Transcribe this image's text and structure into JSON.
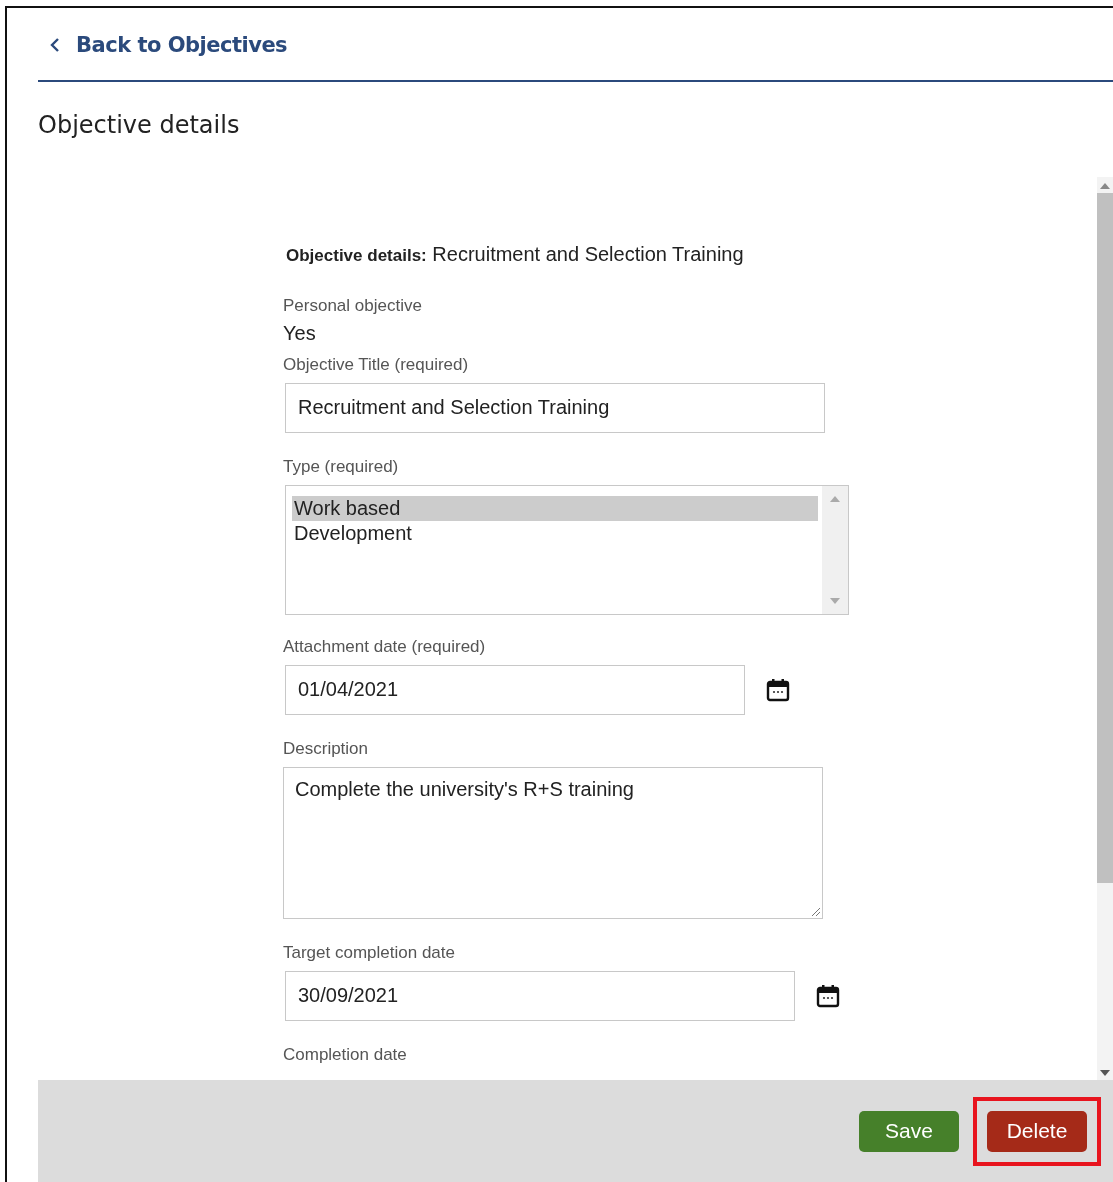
{
  "back_link": {
    "label": "Back to Objectives"
  },
  "page_title": "Objective details",
  "form": {
    "heading_label": "Objective details:",
    "heading_value": "Recruitment and Selection Training",
    "fields": [
      {
        "kind": "readonly",
        "label": "Personal objective",
        "value": "Yes"
      },
      {
        "kind": "text",
        "label": "Objective Title (required)",
        "value": "Recruitment and Selection Training"
      },
      {
        "kind": "listbox",
        "label": "Type (required)",
        "options": [
          {
            "label": "Work based",
            "selected": true
          },
          {
            "label": "Development",
            "selected": false
          }
        ]
      },
      {
        "kind": "date",
        "label": "Attachment date (required)",
        "value": "01/04/2021"
      },
      {
        "kind": "textarea",
        "label": "Description",
        "value": "Complete the university's R+S training"
      },
      {
        "kind": "date",
        "label": "Target completion date",
        "value": "30/09/2021"
      },
      {
        "kind": "label_only",
        "label": "Completion date"
      }
    ]
  },
  "buttons": [
    {
      "label": "Save",
      "kind": "save",
      "highlighted": false
    },
    {
      "label": "Delete",
      "kind": "delete",
      "highlighted": true
    }
  ]
}
